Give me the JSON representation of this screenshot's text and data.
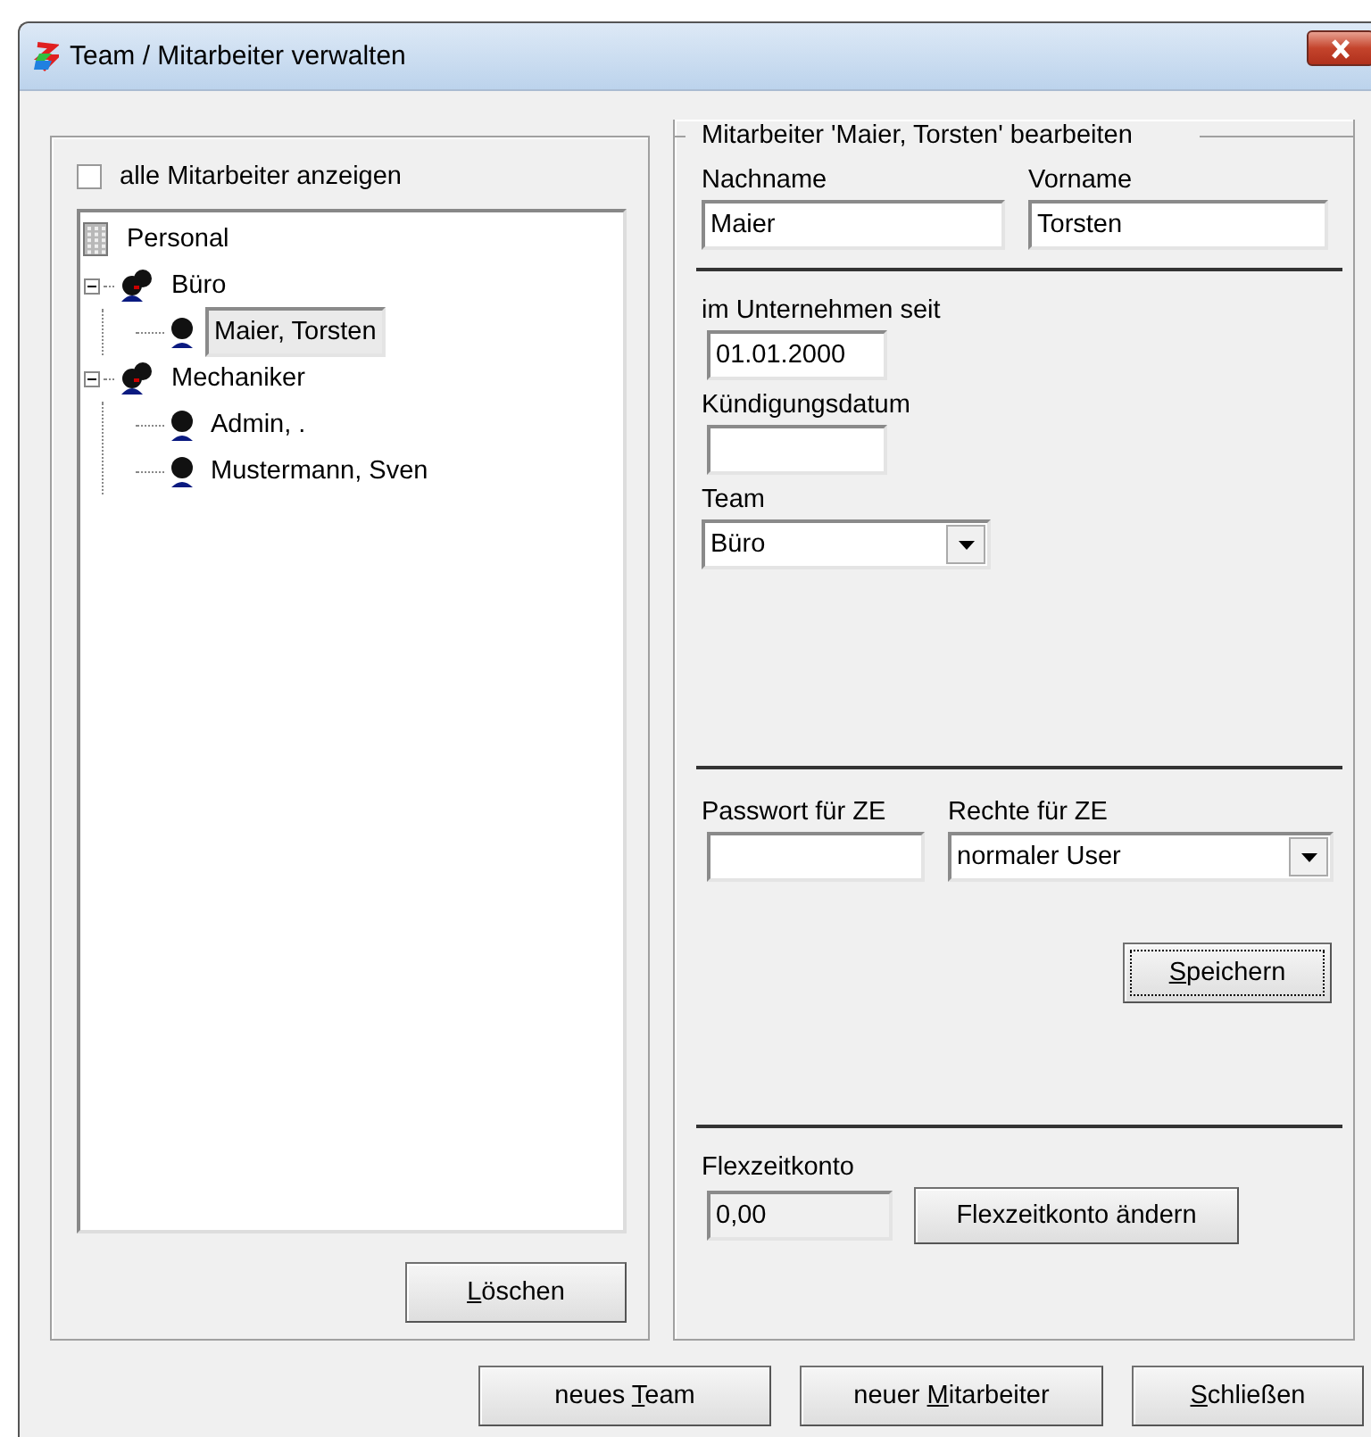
{
  "window": {
    "title": "Team / Mitarbeiter verwalten"
  },
  "left_panel": {
    "show_all": {
      "label": "alle Mitarbeiter anzeigen",
      "checked": false
    },
    "tree": [
      {
        "label": "Personal",
        "kind": "root",
        "selected": false,
        "children": [
          {
            "label": "Büro",
            "kind": "team",
            "selected": false,
            "expanded": true,
            "children": [
              {
                "label": "Maier, Torsten",
                "kind": "person",
                "selected": true
              }
            ]
          },
          {
            "label": "Mechaniker",
            "kind": "team",
            "selected": false,
            "expanded": true,
            "children": [
              {
                "label": "Admin, .",
                "kind": "person",
                "selected": false
              },
              {
                "label": "Mustermann, Sven",
                "kind": "person",
                "selected": false
              }
            ]
          }
        ]
      }
    ],
    "delete_button": {
      "access_key": "L",
      "label_post": "öschen"
    }
  },
  "edit_panel": {
    "legend": "Mitarbeiter 'Maier, Torsten' bearbeiten",
    "last_name": {
      "label": "Nachname",
      "value": "Maier"
    },
    "first_name": {
      "label": "Vorname",
      "value": "Torsten"
    },
    "since": {
      "label": "im Unternehmen seit",
      "value": "01.01.2000"
    },
    "termination": {
      "label": "Kündigungsdatum"
    },
    "team": {
      "label": "Team",
      "value": "Büro"
    },
    "password": {
      "label": "Passwort für ZE"
    },
    "rights": {
      "label": "Rechte für ZE",
      "value": "normaler User"
    },
    "save_button": {
      "access_key": "S",
      "label_post": "peichern",
      "focused": true
    },
    "flex": {
      "label": "Flexzeitkonto",
      "value": "0,00",
      "button": "Flexzeitkonto ändern"
    }
  },
  "footer_buttons": [
    {
      "label_pre": "neues ",
      "access_key": "T",
      "label_post": "eam"
    },
    {
      "label_pre": "neuer ",
      "access_key": "M",
      "label_post": "itarbeiter"
    },
    {
      "access_key": "S",
      "label_post": "chließen"
    }
  ]
}
